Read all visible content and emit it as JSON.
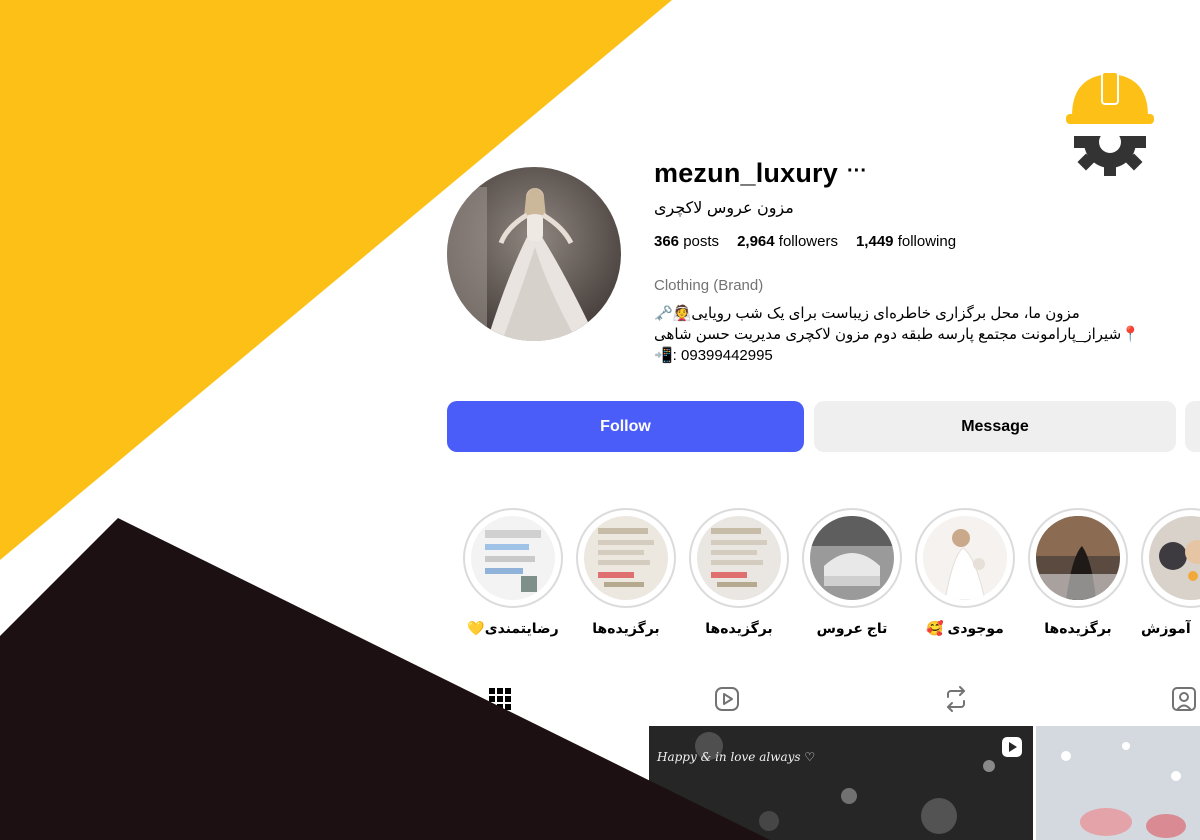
{
  "profile": {
    "username": "mezun_luxury",
    "more_label": "···",
    "full_name": "مزون عروس لاکچری",
    "stats": {
      "posts_count": "366",
      "posts_label": "posts",
      "followers_count": "2,964",
      "followers_label": "followers",
      "following_count": "1,449",
      "following_label": "following"
    },
    "category": "Clothing (Brand)",
    "bio": [
      "مزون ما، محل برگزاری خاطره‌ای زیباست برای یک شب رویایی👰🗝️",
      "📍شیراز_پارامونت مجتمع پارسه طبقه دوم مزون لاکچری مدیریت حسن شاهی",
      "📲: 09399442995"
    ]
  },
  "actions": {
    "follow_label": "Follow",
    "message_label": "Message"
  },
  "highlights": [
    {
      "label": "رضایتمندی💛"
    },
    {
      "label": "برگزیده‌ها"
    },
    {
      "label": "برگزیده‌ها"
    },
    {
      "label": "تاج عروس"
    },
    {
      "label": "موجودی 🥰"
    },
    {
      "label": "برگزیده‌ها"
    },
    {
      "label": "آموزش"
    }
  ],
  "tabs": [
    {
      "name": "posts",
      "icon": "grid-icon"
    },
    {
      "name": "reels",
      "icon": "reels-icon"
    },
    {
      "name": "reposts",
      "icon": "repost-icon"
    },
    {
      "name": "tagged",
      "icon": "tagged-icon"
    }
  ],
  "posts": [
    {
      "caption": "Happy & in love always ♡",
      "type": "reel"
    },
    {
      "caption": "",
      "type": "image"
    }
  ],
  "colors": {
    "accent_yellow": "#FCC016",
    "dark_brown": "#1C1012",
    "follow_blue": "#4A5DF9",
    "button_gray": "#EFEFEF"
  }
}
